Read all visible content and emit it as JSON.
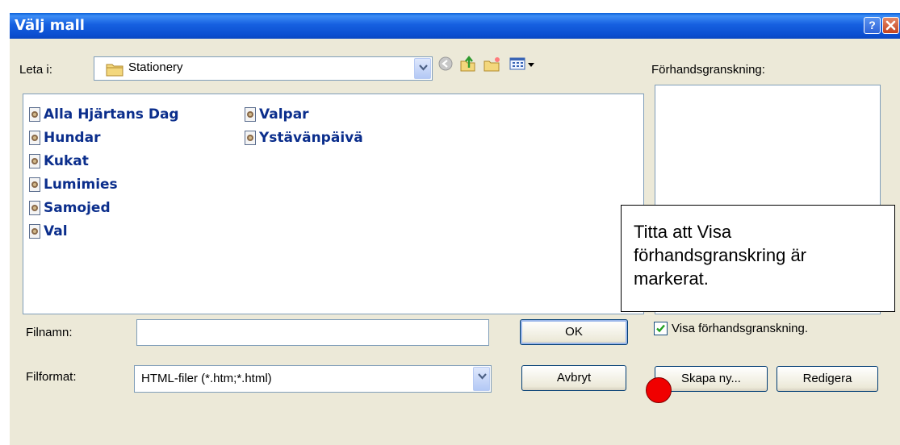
{
  "dialog": {
    "title": "Välj mall",
    "help_label": "?",
    "close_label": "x"
  },
  "lookin": {
    "label": "Leta i:",
    "value": "Stationery"
  },
  "files": {
    "column1": [
      "Alla Hjärtans Dag",
      "Hundar",
      "Kukat",
      "Lumimies",
      "Samojed",
      "Val"
    ],
    "column2": [
      "Valpar",
      "Ystävänpäivä"
    ]
  },
  "preview": {
    "label": "Förhandsgranskning:",
    "checkbox_label": "Visa förhandsgranskning.",
    "checked": true
  },
  "filename": {
    "label": "Filnamn:",
    "value": ""
  },
  "filetype": {
    "label": "Filformat:",
    "value": "HTML-filer (*.htm;*.html)"
  },
  "buttons": {
    "ok": "OK",
    "cancel": "Avbryt",
    "create_new": "Skapa ny...",
    "edit": "Redigera"
  },
  "callout": {
    "line1": "Titta att Visa",
    "line2": "förhandsgranskring är",
    "line3": "markerat."
  },
  "colors": {
    "titlebar": "#0b4fd1",
    "dialog_bg": "#ece9d8",
    "file_text": "#0b2e8c",
    "marker": "#f00000"
  }
}
